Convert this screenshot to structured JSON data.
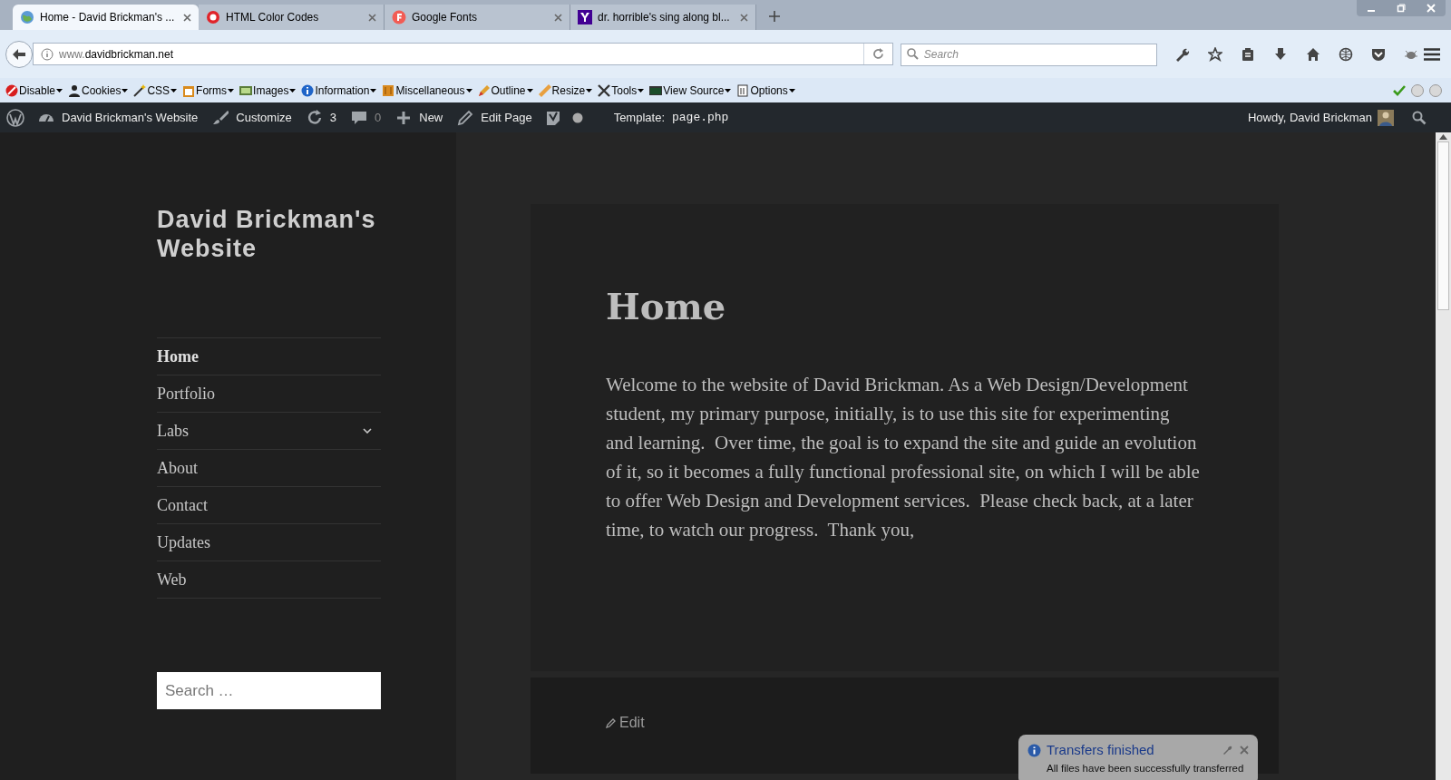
{
  "browser": {
    "tabs": [
      {
        "label": "Home - David Brickman's ...",
        "selected": true
      },
      {
        "label": "HTML Color Codes",
        "selected": false
      },
      {
        "label": "Google Fonts",
        "selected": false
      },
      {
        "label": "dr. horrible's sing along bl...",
        "selected": false
      }
    ],
    "url": {
      "prefix": "www.",
      "domain": "davidbrickman.net"
    },
    "search": {
      "placeholder": "Search"
    }
  },
  "dev_toolbar": {
    "menus": [
      "Disable",
      "Cookies",
      "CSS",
      "Forms",
      "Images",
      "Information",
      "Miscellaneous",
      "Outline",
      "Resize",
      "Tools",
      "View Source",
      "Options"
    ]
  },
  "admin_bar": {
    "items": [
      {
        "label": "David Brickman's Website"
      },
      {
        "label": "Customize"
      },
      {
        "label": "3"
      },
      {
        "label": "0"
      },
      {
        "label": "New"
      },
      {
        "label": "Edit Page"
      }
    ],
    "template_label": "Template:",
    "template_file": "page.php",
    "greeting": "Howdy, David Brickman"
  },
  "site": {
    "title": "David Brickman's Website",
    "nav": [
      {
        "label": "Home",
        "selected": true,
        "expandable": false
      },
      {
        "label": "Portfolio",
        "selected": false,
        "expandable": false
      },
      {
        "label": "Labs",
        "selected": false,
        "expandable": true
      },
      {
        "label": "About",
        "selected": false,
        "expandable": false
      },
      {
        "label": "Contact",
        "selected": false,
        "expandable": false
      },
      {
        "label": "Updates",
        "selected": false,
        "expandable": false
      },
      {
        "label": "Web",
        "selected": false,
        "expandable": false
      }
    ],
    "search": {
      "placeholder": "Search …"
    }
  },
  "page": {
    "title": "Home",
    "body": "Welcome to the website of David Brickman. As a Web Design/Development student, my primary purpose, initially, is to use this site for experimenting and learning.  Over time, the goal is to expand the site and guide an evolution of it, so it becomes a fully functional professional site, on which I will be able to offer Web Design and Development services.  Please check back, at a later time, to watch our progress.  Thank you,",
    "edit": "Edit"
  },
  "notification": {
    "title": "Transfers finished",
    "message": "All files have been successfully transferred"
  }
}
